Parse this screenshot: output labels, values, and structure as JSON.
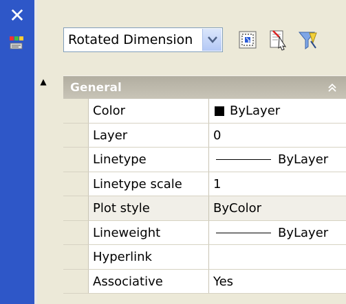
{
  "window": {
    "close_glyph": "✕"
  },
  "toolbar": {
    "object_type": "Rotated Dimension",
    "buttons": [
      {
        "icon": "select-objects-icon"
      },
      {
        "icon": "quick-select-icon"
      },
      {
        "icon": "toggle-pickadd-icon"
      }
    ]
  },
  "group": {
    "title": "General",
    "collapse_glyph": "▲",
    "toggle_glyph": "⌃"
  },
  "properties": [
    {
      "name": "Color",
      "value": "ByLayer",
      "kind": "swatch",
      "swatch_color": "#000000"
    },
    {
      "name": "Layer",
      "value": "0",
      "kind": "text"
    },
    {
      "name": "Linetype",
      "value": "ByLayer",
      "kind": "line"
    },
    {
      "name": "Linetype scale",
      "value": "1",
      "kind": "text"
    },
    {
      "name": "Plot style",
      "value": "ByColor",
      "kind": "text"
    },
    {
      "name": "Lineweight",
      "value": "ByLayer",
      "kind": "line"
    },
    {
      "name": "Hyperlink",
      "value": "",
      "kind": "text"
    },
    {
      "name": "Associative",
      "value": "Yes",
      "kind": "text"
    }
  ],
  "colors": {
    "titlebar": "#2e57c8",
    "panel": "#ece9d8",
    "header": "#b2aea0"
  }
}
